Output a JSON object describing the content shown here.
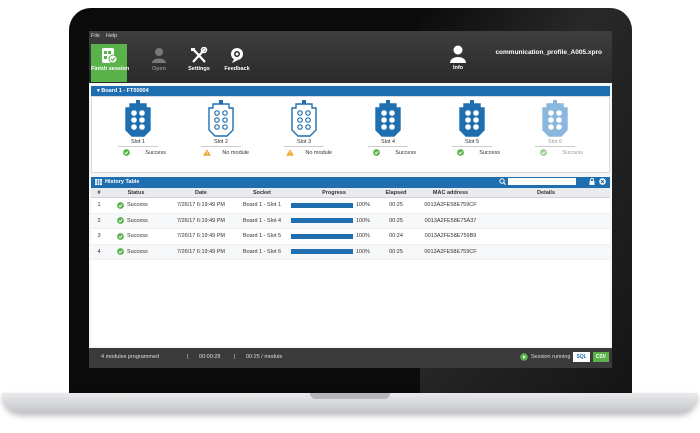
{
  "menu": {
    "file": "File",
    "help": "Help"
  },
  "toolbar": {
    "finish": "Finish session",
    "open": "Open",
    "settings": "Settings",
    "feedback": "Feedback",
    "info": "Info",
    "profile_name": "communication_profile_A005.xpro"
  },
  "board": {
    "title": "Board 1 - FT00004",
    "slots": [
      {
        "label": "Slot 1",
        "status": "Success",
        "state": "success"
      },
      {
        "label": "Slot 2",
        "status": "No module",
        "state": "warning"
      },
      {
        "label": "Slot 3",
        "status": "No module",
        "state": "warning"
      },
      {
        "label": "Slot 4",
        "status": "Success",
        "state": "success"
      },
      {
        "label": "Slot 5",
        "status": "Success",
        "state": "success"
      },
      {
        "label": "Slot 6",
        "status": "Success",
        "state": "success"
      }
    ]
  },
  "history": {
    "title": "History Table",
    "search_placeholder": "",
    "columns": [
      "#",
      "Status",
      "Date",
      "Socket",
      "Progress",
      "Elapsed",
      "MAC address",
      "Details"
    ],
    "rows": [
      {
        "num": "1",
        "status": "Success",
        "date": "7/26/17 6:19:49 PM",
        "socket": "Board 1 - Slot 1",
        "progress": 100,
        "progress_text": "100%",
        "elapsed": "00:25",
        "mac": "0013A2FE58E759CF",
        "details": ""
      },
      {
        "num": "2",
        "status": "Success",
        "date": "7/26/17 6:19:49 PM",
        "socket": "Board 1 - Slot 4",
        "progress": 100,
        "progress_text": "100%",
        "elapsed": "00:25",
        "mac": "0013A2FE58E75A37",
        "details": ""
      },
      {
        "num": "3",
        "status": "Success",
        "date": "7/26/17 6:19:49 PM",
        "socket": "Board 1 - Slot 5",
        "progress": 100,
        "progress_text": "100%",
        "elapsed": "00:24",
        "mac": "0013A2FE58E759B9",
        "details": ""
      },
      {
        "num": "4",
        "status": "Success",
        "date": "7/26/17 6:19:49 PM",
        "socket": "Board 1 - Slot 6",
        "progress": 100,
        "progress_text": "100%",
        "elapsed": "00:25",
        "mac": "0013A2FE58E759CF",
        "details": ""
      }
    ]
  },
  "statusbar": {
    "modules": "4 modules programmed",
    "sep": "|",
    "elapsed": "00:00:28",
    "rate": "00:25 / module",
    "session": "Session running",
    "sql": "SQL",
    "csv": "CSV"
  },
  "colors": {
    "accent": "#1f6fb0",
    "success": "#59b34a",
    "warning": "#f0a020"
  }
}
